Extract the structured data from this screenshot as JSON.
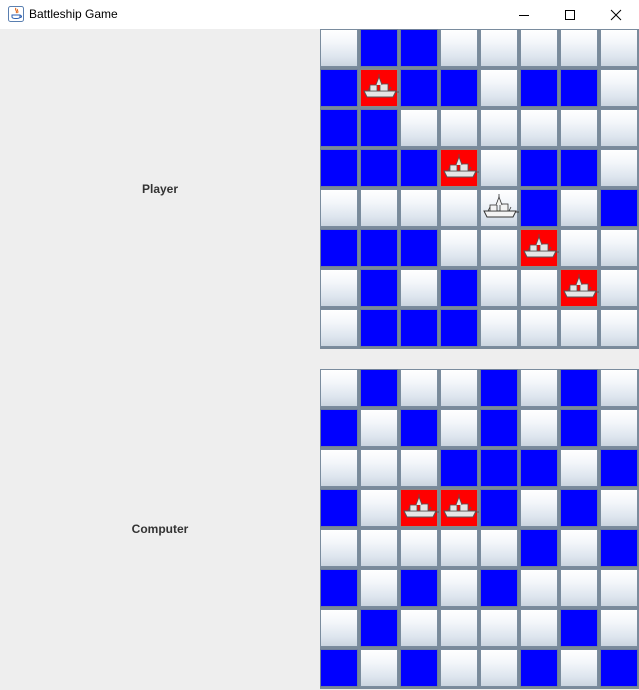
{
  "window": {
    "title": "Battleship Game"
  },
  "colors": {
    "water": "#0000ff",
    "hit": "#ff0000"
  },
  "player": {
    "label": "Player",
    "grid": [
      [
        "E",
        "W",
        "W",
        "E",
        "E",
        "E",
        "E",
        "E"
      ],
      [
        "W",
        "H",
        "W",
        "W",
        "E",
        "W",
        "W",
        "E"
      ],
      [
        "W",
        "W",
        "E",
        "E",
        "E",
        "E",
        "E",
        "E"
      ],
      [
        "W",
        "W",
        "W",
        "H",
        "E",
        "W",
        "W",
        "E"
      ],
      [
        "E",
        "E",
        "E",
        "E",
        "S",
        "W",
        "E",
        "W"
      ],
      [
        "W",
        "W",
        "W",
        "E",
        "E",
        "H",
        "E",
        "E"
      ],
      [
        "E",
        "W",
        "E",
        "W",
        "E",
        "E",
        "H",
        "E"
      ],
      [
        "E",
        "W",
        "W",
        "W",
        "E",
        "E",
        "E",
        "E"
      ]
    ]
  },
  "computer": {
    "label": "Computer",
    "grid": [
      [
        "E",
        "W",
        "E",
        "E",
        "W",
        "E",
        "W",
        "E"
      ],
      [
        "W",
        "E",
        "W",
        "E",
        "W",
        "E",
        "W",
        "E"
      ],
      [
        "E",
        "E",
        "E",
        "W",
        "W",
        "W",
        "E",
        "W"
      ],
      [
        "W",
        "E",
        "H",
        "H",
        "W",
        "E",
        "W",
        "E"
      ],
      [
        "E",
        "E",
        "E",
        "E",
        "E",
        "W",
        "E",
        "W"
      ],
      [
        "W",
        "E",
        "W",
        "E",
        "W",
        "E",
        "E",
        "E"
      ],
      [
        "E",
        "W",
        "E",
        "E",
        "E",
        "E",
        "W",
        "E"
      ],
      [
        "W",
        "E",
        "W",
        "E",
        "E",
        "W",
        "E",
        "W"
      ]
    ]
  },
  "legend": {
    "W": "water",
    "E": "empty",
    "H": "hit-ship",
    "S": "ship"
  }
}
